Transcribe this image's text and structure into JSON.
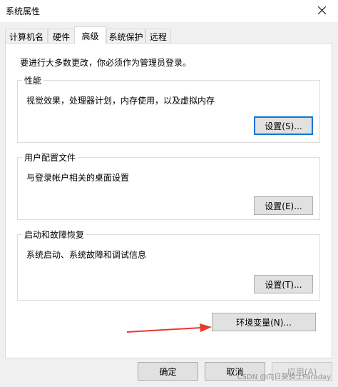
{
  "window": {
    "title": "系统属性",
    "close_icon": "close-icon"
  },
  "tabs": [
    {
      "label": "计算机名",
      "active": false
    },
    {
      "label": "硬件",
      "active": false
    },
    {
      "label": "高级",
      "active": true
    },
    {
      "label": "系统保护",
      "active": false
    },
    {
      "label": "远程",
      "active": false
    }
  ],
  "advanced": {
    "notice": "要进行大多数更改，你必须作为管理员登录。",
    "performance": {
      "title": "性能",
      "description": "视觉效果，处理器计划，内存使用，以及虚拟内存",
      "button": "设置(S)..."
    },
    "user_profiles": {
      "title": "用户配置文件",
      "description": "与登录帐户相关的桌面设置",
      "button": "设置(E)..."
    },
    "startup_recovery": {
      "title": "启动和故障恢复",
      "description": "系统启动、系统故障和调试信息",
      "button": "设置(T)..."
    },
    "env_button": "环境变量(N)..."
  },
  "footer": {
    "ok": "确定",
    "cancel": "取消",
    "apply": "应用(A)"
  },
  "annotation": {
    "arrow_color": "#e8392e"
  },
  "watermark": "CSDN @向日葵骑士Faraday"
}
